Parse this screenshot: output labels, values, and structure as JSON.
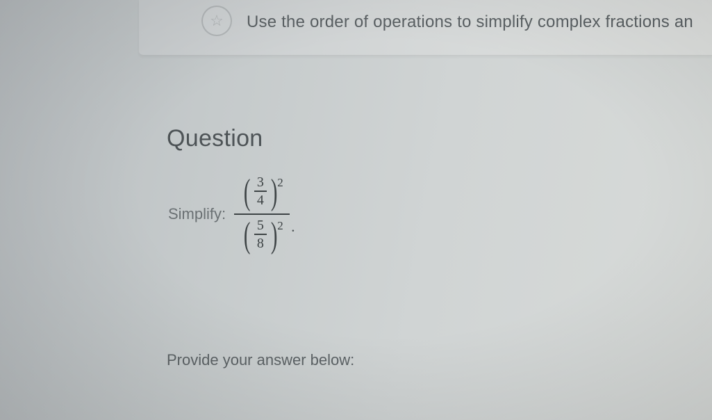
{
  "header": {
    "topic_text": "Use the order of operations to simplify complex fractions an",
    "star_glyph": "☆"
  },
  "question": {
    "heading": "Question",
    "simplify_label": "Simplify:",
    "frac_top": {
      "numer": "3",
      "denom": "4",
      "power": "2"
    },
    "frac_bottom": {
      "numer": "5",
      "denom": "8",
      "power": "2"
    },
    "period": "."
  },
  "answer": {
    "prompt": "Provide your answer below:"
  }
}
